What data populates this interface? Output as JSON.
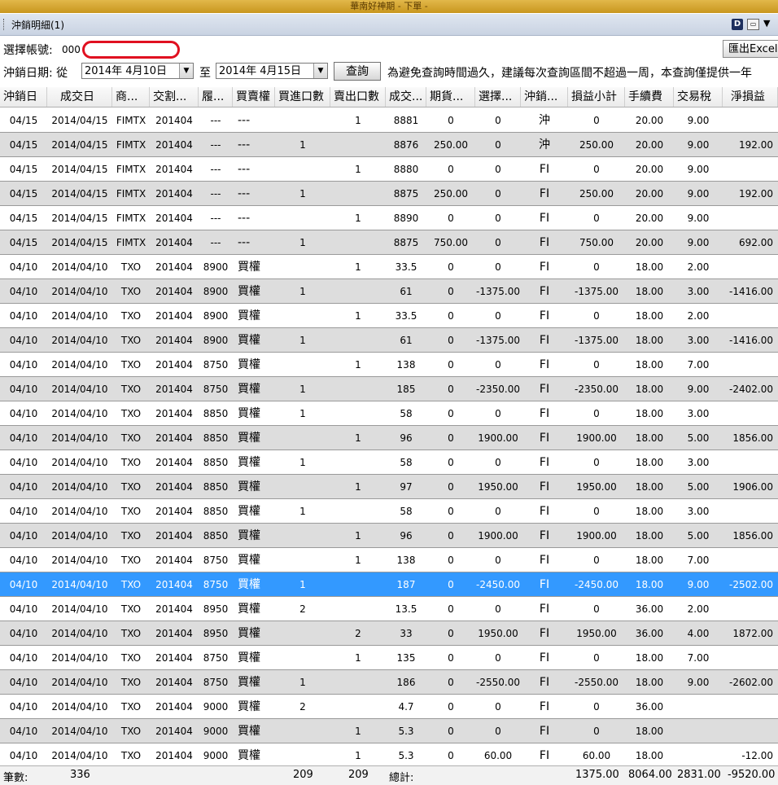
{
  "window": {
    "title": "華南好神期 - 下單 -"
  },
  "panel": {
    "title": "沖銷明細(1)",
    "d_icon_label": "D"
  },
  "account": {
    "label": "選擇帳號:",
    "value": "000"
  },
  "export_button": "匯出Excel",
  "date_filter": {
    "label": "沖銷日期: 從",
    "from": "2014年  4月10日",
    "to_label": "至",
    "to": "2014年  4月15日",
    "query_button": "查詢",
    "notice": "為避免查詢時間過久，建議每次查詢區間不超過一周，本查詢僅提供一年"
  },
  "columns": [
    "沖銷日",
    "成交日",
    "商...",
    "交割...",
    "履...",
    "買賣權",
    "買進口數",
    "賣出口數",
    "成交...",
    "期貨...",
    "選擇...",
    "沖銷...",
    "損益小計",
    "手續費",
    "交易稅",
    "淨損益"
  ],
  "rows": [
    [
      "04/15",
      "2014/04/15",
      "FIMTX",
      "201404",
      "---",
      "---",
      "",
      "1",
      "8881",
      "0",
      "0",
      "沖",
      "0",
      "20.00",
      "9.00",
      ""
    ],
    [
      "04/15",
      "2014/04/15",
      "FIMTX",
      "201404",
      "---",
      "---",
      "1",
      "",
      "8876",
      "250.00",
      "0",
      "沖",
      "250.00",
      "20.00",
      "9.00",
      "192.00"
    ],
    [
      "04/15",
      "2014/04/15",
      "FIMTX",
      "201404",
      "---",
      "---",
      "",
      "1",
      "8880",
      "0",
      "0",
      "FI",
      "0",
      "20.00",
      "9.00",
      ""
    ],
    [
      "04/15",
      "2014/04/15",
      "FIMTX",
      "201404",
      "---",
      "---",
      "1",
      "",
      "8875",
      "250.00",
      "0",
      "FI",
      "250.00",
      "20.00",
      "9.00",
      "192.00"
    ],
    [
      "04/15",
      "2014/04/15",
      "FIMTX",
      "201404",
      "---",
      "---",
      "",
      "1",
      "8890",
      "0",
      "0",
      "FI",
      "0",
      "20.00",
      "9.00",
      ""
    ],
    [
      "04/15",
      "2014/04/15",
      "FIMTX",
      "201404",
      "---",
      "---",
      "1",
      "",
      "8875",
      "750.00",
      "0",
      "FI",
      "750.00",
      "20.00",
      "9.00",
      "692.00"
    ],
    [
      "04/10",
      "2014/04/10",
      "TXO",
      "201404",
      "8900",
      "買權",
      "",
      "1",
      "33.5",
      "0",
      "0",
      "FI",
      "0",
      "18.00",
      "2.00",
      ""
    ],
    [
      "04/10",
      "2014/04/10",
      "TXO",
      "201404",
      "8900",
      "買權",
      "1",
      "",
      "61",
      "0",
      "-1375.00",
      "FI",
      "-1375.00",
      "18.00",
      "3.00",
      "-1416.00"
    ],
    [
      "04/10",
      "2014/04/10",
      "TXO",
      "201404",
      "8900",
      "買權",
      "",
      "1",
      "33.5",
      "0",
      "0",
      "FI",
      "0",
      "18.00",
      "2.00",
      ""
    ],
    [
      "04/10",
      "2014/04/10",
      "TXO",
      "201404",
      "8900",
      "買權",
      "1",
      "",
      "61",
      "0",
      "-1375.00",
      "FI",
      "-1375.00",
      "18.00",
      "3.00",
      "-1416.00"
    ],
    [
      "04/10",
      "2014/04/10",
      "TXO",
      "201404",
      "8750",
      "買權",
      "",
      "1",
      "138",
      "0",
      "0",
      "FI",
      "0",
      "18.00",
      "7.00",
      ""
    ],
    [
      "04/10",
      "2014/04/10",
      "TXO",
      "201404",
      "8750",
      "買權",
      "1",
      "",
      "185",
      "0",
      "-2350.00",
      "FI",
      "-2350.00",
      "18.00",
      "9.00",
      "-2402.00"
    ],
    [
      "04/10",
      "2014/04/10",
      "TXO",
      "201404",
      "8850",
      "買權",
      "1",
      "",
      "58",
      "0",
      "0",
      "FI",
      "0",
      "18.00",
      "3.00",
      ""
    ],
    [
      "04/10",
      "2014/04/10",
      "TXO",
      "201404",
      "8850",
      "買權",
      "",
      "1",
      "96",
      "0",
      "1900.00",
      "FI",
      "1900.00",
      "18.00",
      "5.00",
      "1856.00"
    ],
    [
      "04/10",
      "2014/04/10",
      "TXO",
      "201404",
      "8850",
      "買權",
      "1",
      "",
      "58",
      "0",
      "0",
      "FI",
      "0",
      "18.00",
      "3.00",
      ""
    ],
    [
      "04/10",
      "2014/04/10",
      "TXO",
      "201404",
      "8850",
      "買權",
      "",
      "1",
      "97",
      "0",
      "1950.00",
      "FI",
      "1950.00",
      "18.00",
      "5.00",
      "1906.00"
    ],
    [
      "04/10",
      "2014/04/10",
      "TXO",
      "201404",
      "8850",
      "買權",
      "1",
      "",
      "58",
      "0",
      "0",
      "FI",
      "0",
      "18.00",
      "3.00",
      ""
    ],
    [
      "04/10",
      "2014/04/10",
      "TXO",
      "201404",
      "8850",
      "買權",
      "",
      "1",
      "96",
      "0",
      "1900.00",
      "FI",
      "1900.00",
      "18.00",
      "5.00",
      "1856.00"
    ],
    [
      "04/10",
      "2014/04/10",
      "TXO",
      "201404",
      "8750",
      "買權",
      "",
      "1",
      "138",
      "0",
      "0",
      "FI",
      "0",
      "18.00",
      "7.00",
      ""
    ],
    [
      "04/10",
      "2014/04/10",
      "TXO",
      "201404",
      "8750",
      "買權",
      "1",
      "",
      "187",
      "0",
      "-2450.00",
      "FI",
      "-2450.00",
      "18.00",
      "9.00",
      "-2502.00"
    ],
    [
      "04/10",
      "2014/04/10",
      "TXO",
      "201404",
      "8950",
      "買權",
      "2",
      "",
      "13.5",
      "0",
      "0",
      "FI",
      "0",
      "36.00",
      "2.00",
      ""
    ],
    [
      "04/10",
      "2014/04/10",
      "TXO",
      "201404",
      "8950",
      "買權",
      "",
      "2",
      "33",
      "0",
      "1950.00",
      "FI",
      "1950.00",
      "36.00",
      "4.00",
      "1872.00"
    ],
    [
      "04/10",
      "2014/04/10",
      "TXO",
      "201404",
      "8750",
      "買權",
      "",
      "1",
      "135",
      "0",
      "0",
      "FI",
      "0",
      "18.00",
      "7.00",
      ""
    ],
    [
      "04/10",
      "2014/04/10",
      "TXO",
      "201404",
      "8750",
      "買權",
      "1",
      "",
      "186",
      "0",
      "-2550.00",
      "FI",
      "-2550.00",
      "18.00",
      "9.00",
      "-2602.00"
    ],
    [
      "04/10",
      "2014/04/10",
      "TXO",
      "201404",
      "9000",
      "買權",
      "2",
      "",
      "4.7",
      "0",
      "0",
      "FI",
      "0",
      "36.00",
      "",
      ""
    ],
    [
      "04/10",
      "2014/04/10",
      "TXO",
      "201404",
      "9000",
      "買權",
      "",
      "1",
      "5.3",
      "0",
      "0",
      "FI",
      "0",
      "18.00",
      "",
      ""
    ],
    [
      "04/10",
      "2014/04/10",
      "TXO",
      "201404",
      "9000",
      "買權",
      "",
      "1",
      "5.3",
      "0",
      "60.00",
      "FI",
      "60.00",
      "18.00",
      "",
      "-12.00"
    ]
  ],
  "selected_row_index": 19,
  "footer": {
    "count_label": "筆數:",
    "count": "336",
    "buy_total": "209",
    "sell_total": "209",
    "total_label": "總計:",
    "pnl_total": "1375.00",
    "fee_total": "8064.00",
    "tax_total": "2831.00",
    "net_total": "-9520.00"
  }
}
